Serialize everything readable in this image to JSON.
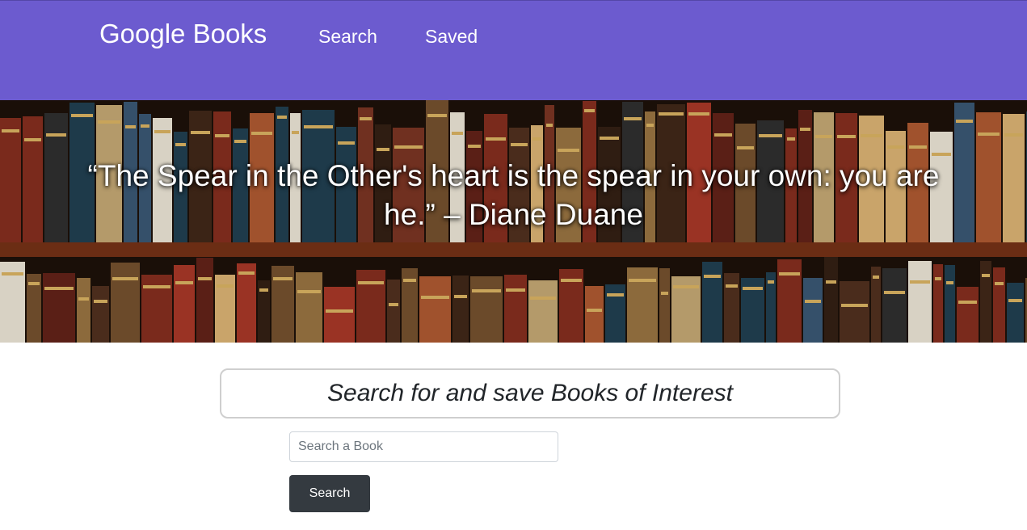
{
  "navbar": {
    "brand": "Google Books",
    "links": [
      {
        "label": "Search"
      },
      {
        "label": "Saved"
      }
    ]
  },
  "hero": {
    "quote": "“The Spear in the Other's heart is the spear in your own: you are he.” – Diane Duane"
  },
  "jumbotron": {
    "heading": "Search for and save Books of Interest"
  },
  "search": {
    "placeholder": "Search a Book",
    "value": "",
    "button_label": "Search"
  },
  "colors": {
    "navbar_bg": "#6c5bcf",
    "button_bg": "#343a40"
  }
}
